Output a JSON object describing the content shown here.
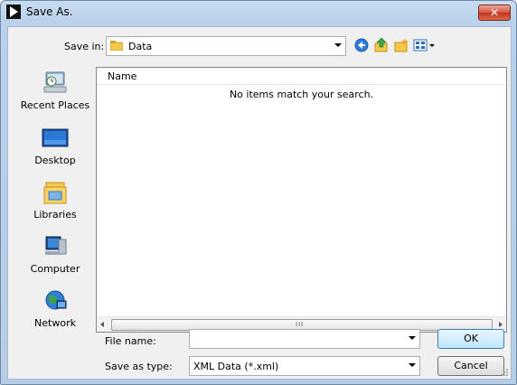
{
  "window": {
    "title": "Save As.",
    "close_label": "✕"
  },
  "toolbar": {
    "save_in_label": "Save in:",
    "save_in_value": "Data"
  },
  "places": [
    {
      "label": "Recent Places",
      "icon": "recent-places-icon"
    },
    {
      "label": "Desktop",
      "icon": "desktop-icon"
    },
    {
      "label": "Libraries",
      "icon": "libraries-icon"
    },
    {
      "label": "Computer",
      "icon": "computer-icon"
    },
    {
      "label": "Network",
      "icon": "network-icon"
    }
  ],
  "file_list": {
    "column_name": "Name",
    "empty_message": "No items match your search.",
    "scroll_grip": "III"
  },
  "form": {
    "file_name_label": "File name:",
    "file_name_value": "",
    "save_type_label": "Save as type:",
    "save_type_value": "XML Data (*.xml)"
  },
  "buttons": {
    "ok": "OK",
    "cancel": "Cancel"
  },
  "colors": {
    "titlebar": "#c9dcf0",
    "close": "#c3361f",
    "dialog_bg": "#f0f0f0"
  }
}
